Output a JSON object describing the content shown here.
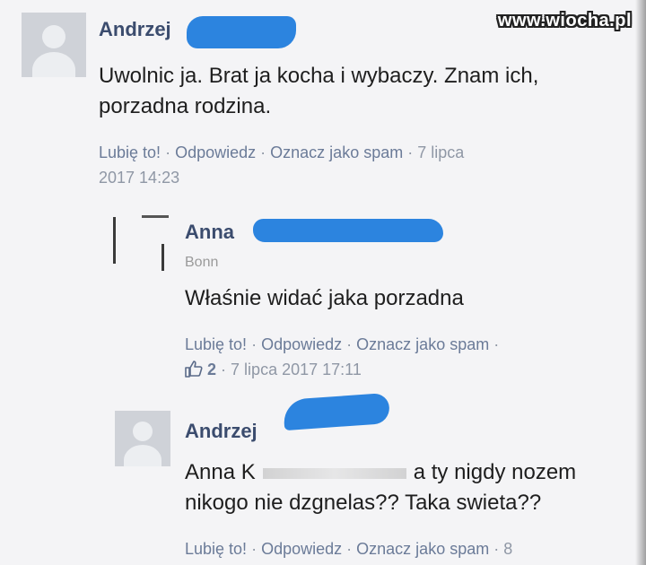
{
  "watermark": "www.wiocha.pl",
  "colors": {
    "author": "#3b4c6e",
    "link": "#6b7b98",
    "meta": "#8f97a5",
    "redaction": "#2c84df"
  },
  "comments": [
    {
      "author": "Andrzej",
      "text_line1": "Uwolnic ja. Brat ja kocha i wybaczy. Znam ich,",
      "text_line2": "porzadna rodzina.",
      "like": "Lubię to!",
      "reply": "Odpowiedz",
      "spam": "Oznacz jako spam",
      "date_part1": "7 lipca",
      "date_part2": "2017 14:23"
    },
    {
      "author": "Anna",
      "location": "Bonn",
      "text_line1": "Właśnie widać jaka porzadna",
      "like": "Lubię to!",
      "reply": "Odpowiedz",
      "spam": "Oznacz jako spam",
      "likes_count": "2",
      "date": "7 lipca 2017 17:11"
    },
    {
      "author": "Andrzej",
      "text_prefix": "Anna K",
      "text_suffix": "a ty nigdy nozem",
      "text_line2": "nikogo nie dzgnelas?? Taka swieta??",
      "like": "Lubię to!",
      "reply": "Odpowiedz",
      "spam": "Oznacz jako spam",
      "date_part1": "8"
    }
  ]
}
